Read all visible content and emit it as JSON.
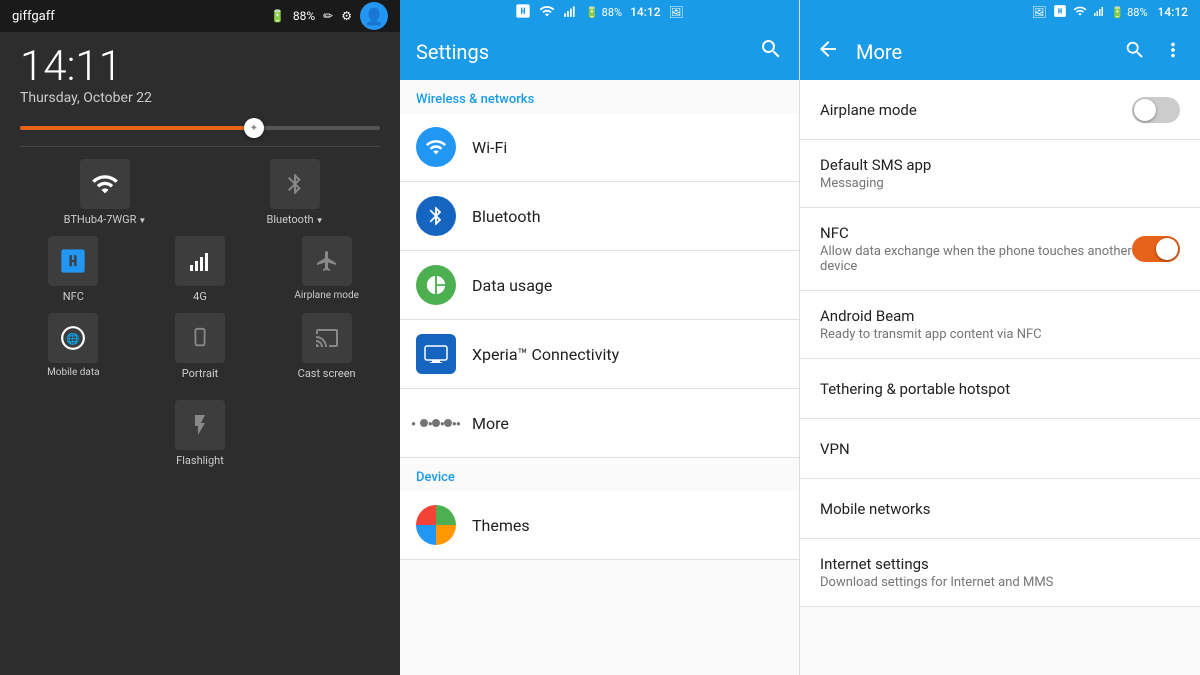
{
  "left": {
    "carrier": "giffgaff",
    "battery": "88%",
    "time": "14:11",
    "date": "Thursday, October 22",
    "toggles_row1": [
      {
        "id": "wifi",
        "label": "BTHub4-7WGR",
        "active": true,
        "icon": "wifi"
      },
      {
        "id": "bluetooth",
        "label": "Bluetooth",
        "active": false,
        "icon": "bt"
      }
    ],
    "toggles_row2": [
      {
        "id": "nfc",
        "label": "NFC",
        "active": true,
        "icon": "nfc"
      },
      {
        "id": "4g",
        "label": "4G",
        "active": true,
        "icon": "4g"
      },
      {
        "id": "airplane",
        "label": "Airplane mode",
        "active": false,
        "icon": "plane"
      }
    ],
    "toggles_row3": [
      {
        "id": "mobile_data",
        "label": "Mobile data",
        "active": true,
        "icon": "globe"
      },
      {
        "id": "portrait",
        "label": "Portrait",
        "active": false,
        "icon": "portrait"
      },
      {
        "id": "cast",
        "label": "Cast screen",
        "active": false,
        "icon": "cast"
      }
    ],
    "flashlight": {
      "label": "Flashlight",
      "active": false
    }
  },
  "middle": {
    "header": {
      "title": "Settings",
      "search_icon": "search"
    },
    "status_bar": {
      "time": "14:12",
      "battery": "88%"
    },
    "section_wireless": "Wireless & networks",
    "section_device": "Device",
    "items": [
      {
        "id": "wifi",
        "icon_color": "blue",
        "icon": "wifi",
        "label": "Wi-Fi",
        "sublabel": ""
      },
      {
        "id": "bluetooth",
        "icon_color": "blue-dark",
        "icon": "bluetooth",
        "label": "Bluetooth",
        "sublabel": ""
      },
      {
        "id": "data_usage",
        "icon_color": "green",
        "icon": "chart",
        "label": "Data usage",
        "sublabel": ""
      },
      {
        "id": "xperia",
        "icon_color": "blue",
        "icon": "monitor",
        "label": "Xperia™ Connectivity",
        "sublabel": ""
      },
      {
        "id": "more",
        "icon_color": "gray",
        "icon": "dots",
        "label": "More",
        "sublabel": ""
      },
      {
        "id": "themes",
        "icon_color": "multi",
        "icon": "themes",
        "label": "Themes",
        "sublabel": ""
      }
    ]
  },
  "right": {
    "header": {
      "title": "More",
      "back_icon": "back",
      "search_icon": "search",
      "menu_icon": "menu"
    },
    "status_bar": {
      "time": "14:12",
      "battery": "88%"
    },
    "items": [
      {
        "id": "airplane",
        "title": "Airplane mode",
        "subtitle": "",
        "toggle": true,
        "toggle_state": "off"
      },
      {
        "id": "default_sms",
        "title": "Default SMS app",
        "subtitle": "Messaging",
        "toggle": false
      },
      {
        "id": "nfc",
        "title": "NFC",
        "subtitle": "Allow data exchange when the phone touches another device",
        "toggle": true,
        "toggle_state": "on"
      },
      {
        "id": "android_beam",
        "title": "Android Beam",
        "subtitle": "Ready to transmit app content via NFC",
        "toggle": false
      },
      {
        "id": "tethering",
        "title": "Tethering & portable hotspot",
        "subtitle": "",
        "toggle": false
      },
      {
        "id": "vpn",
        "title": "VPN",
        "subtitle": "",
        "toggle": false
      },
      {
        "id": "mobile_networks",
        "title": "Mobile networks",
        "subtitle": "",
        "toggle": false
      },
      {
        "id": "internet_settings",
        "title": "Internet settings",
        "subtitle": "Download settings for Internet and MMS",
        "toggle": false
      }
    ]
  }
}
